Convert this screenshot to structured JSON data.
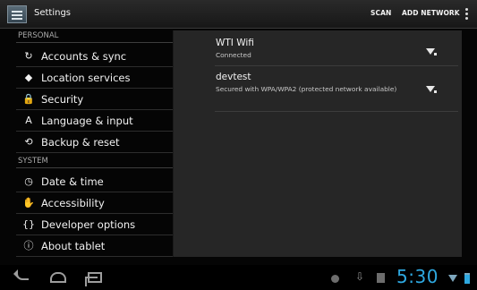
{
  "action_bar": {
    "app_icon": "settings-app-icon",
    "title": "Settings",
    "actions": [
      {
        "label": "SCAN"
      },
      {
        "label": "ADD NETWORK"
      }
    ],
    "overflow_icon": "vertical-ellipsis-icon"
  },
  "settings": {
    "sections": [
      {
        "title": "PERSONAL",
        "items": [
          {
            "label": "Accounts & sync",
            "icon_name": "sync-icon",
            "glyph": "↻"
          },
          {
            "label": "Location services",
            "icon_name": "location-icon",
            "glyph": "◆"
          },
          {
            "label": "Security",
            "icon_name": "lock-icon",
            "glyph": "🔒"
          },
          {
            "label": "Language & input",
            "icon_name": "keyboard-icon",
            "glyph": "A"
          },
          {
            "label": "Backup & reset",
            "icon_name": "backup-icon",
            "glyph": "⟲"
          }
        ]
      },
      {
        "title": "SYSTEM",
        "items": [
          {
            "label": "Date & time",
            "icon_name": "clock-icon",
            "glyph": "◷"
          },
          {
            "label": "Accessibility",
            "icon_name": "hand-icon",
            "glyph": "✋"
          },
          {
            "label": "Developer options",
            "icon_name": "braces-icon",
            "glyph": "{}"
          },
          {
            "label": "About tablet",
            "icon_name": "info-icon",
            "glyph": "ⓘ"
          }
        ]
      }
    ]
  },
  "wifi": {
    "networks": [
      {
        "name": "WTI Wifi",
        "status": "Connected",
        "signal_icon": "wifi-signal-icon"
      },
      {
        "name": "devtest",
        "status": "Secured with WPA/WPA2 (protected network available)",
        "signal_icon": "wifi-secured-icon"
      }
    ]
  },
  "navigation": {
    "back_icon": "back-icon",
    "home_icon": "home-icon",
    "recent_apps_icon": "recent-apps-icon"
  },
  "status_bar": {
    "time": "5:30",
    "icons": [
      "bug-icon",
      "download-icon",
      "sd-card-icon",
      "wifi-status-icon",
      "battery-icon"
    ]
  },
  "colors": {
    "accent": "#2ea8e0",
    "panel": "#262626",
    "background": "#050505"
  }
}
